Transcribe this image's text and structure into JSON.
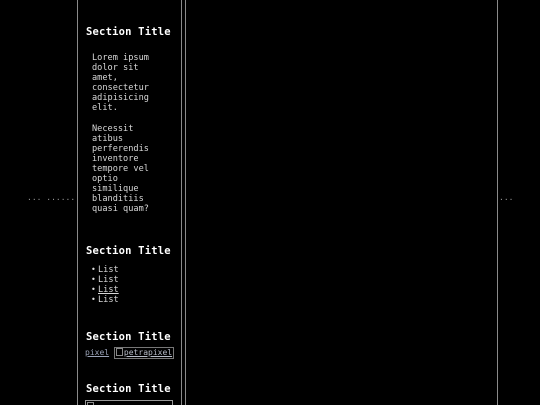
{
  "left_dots": "... ......",
  "right_dots": "...",
  "sidebar": {
    "sections": [
      {
        "title": "Section Title",
        "paragraphs": [
          "Lorem ipsum dolor sit amet, consectetur adipisicing elit.",
          "Necessit atibus perferendis inventore tempore vel optio similique blanditiis quasi quam?"
        ]
      },
      {
        "title": "Section Title",
        "list": [
          "List",
          "List",
          "List",
          "List"
        ]
      },
      {
        "title": "Section Title",
        "badges": {
          "text_link": "pixel",
          "image_alt": "petrapixel"
        }
      },
      {
        "title": "Section Title"
      }
    ]
  }
}
